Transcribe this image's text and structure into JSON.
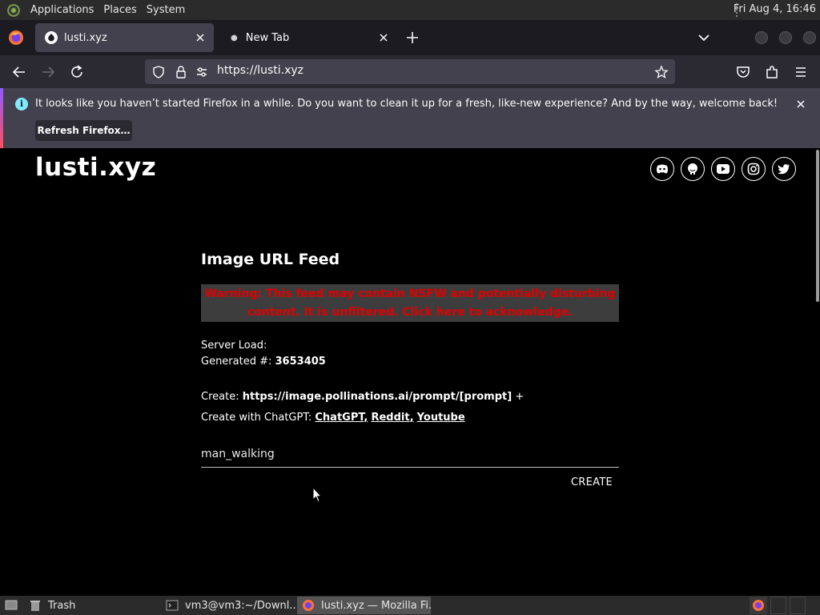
{
  "top_panel": {
    "menus": [
      "Applications",
      "Places",
      "System"
    ],
    "clock": "Fri Aug  4, 16:46"
  },
  "tabs": [
    {
      "title": "lusti.xyz",
      "active": true
    },
    {
      "title": "New Tab",
      "active": false
    }
  ],
  "navbar": {
    "url": "https://lusti.xyz"
  },
  "notification": {
    "message": "It looks like you haven’t started Firefox in a while. Do you want to clean it up for a fresh, like-new experience? And by the way, welcome back!",
    "button_label": "Refresh Firefox…"
  },
  "page": {
    "logo": "lusti.xyz",
    "social_icons": [
      "discord-icon",
      "github-icon",
      "youtube-icon",
      "instagram-icon",
      "twitter-icon"
    ],
    "feed_title": "Image URL Feed",
    "warning_line1": "Warning: This feed may contain NSFW and potentially disturbing",
    "warning_line2": "content. It is unfiltered. Click here to acknowledge.",
    "server_load_label": "Server Load:",
    "generated_label": "Generated #:",
    "generated_value": "3653405",
    "create_label": "Create:",
    "create_url": "https://image.pollinations.ai/prompt/[prompt]",
    "create_plus": "+",
    "chatgpt_label": "Create with ChatGPT:",
    "chatgpt_links": [
      "ChatGPT",
      "Reddit",
      "Youtube"
    ],
    "prompt_value": "man_walking",
    "create_button": "CREATE"
  },
  "taskbar": {
    "items": [
      {
        "label": "Trash"
      },
      {
        "label": "vm3@vm3:~/Downl..."
      },
      {
        "label": "lusti.xyz — Mozilla Fi..."
      }
    ]
  },
  "colors": {
    "warning_text": "#e00000",
    "page_bg": "#000000",
    "tabbar_bg": "#1c1b22",
    "navbar_bg": "#2b2a33",
    "notification_bg": "#42414d"
  }
}
